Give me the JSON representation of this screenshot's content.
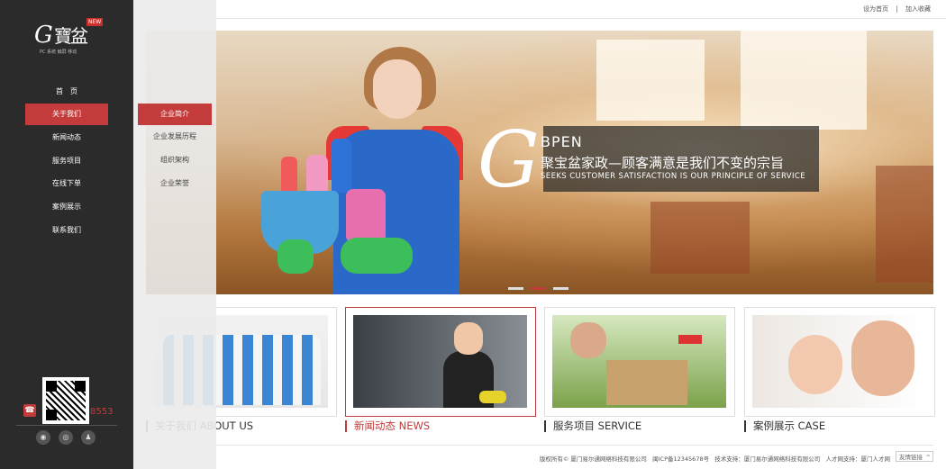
{
  "sidebar": {
    "logo": {
      "letter": "G",
      "chinese": "寶盆",
      "badge": "NEW",
      "subtitle": "PC 系统 触屏 移动"
    },
    "nav": [
      {
        "label": "首　页",
        "active": false
      },
      {
        "label": "关于我们",
        "active": true
      },
      {
        "label": "新闻动态",
        "active": false
      },
      {
        "label": "服务项目",
        "active": false
      },
      {
        "label": "在线下单",
        "active": false
      },
      {
        "label": "案例展示",
        "active": false
      },
      {
        "label": "联系我们",
        "active": false
      }
    ],
    "phone_icon": "phone-icon",
    "phone_partial": "8553",
    "social": [
      {
        "icon": "weibo-icon",
        "glyph": "◉"
      },
      {
        "icon": "wechat-icon",
        "glyph": "◎"
      },
      {
        "icon": "qq-icon",
        "glyph": "♟"
      }
    ]
  },
  "subnav": {
    "items": [
      {
        "label": "企业简介",
        "active": true
      },
      {
        "label": "企业发展历程",
        "active": false
      },
      {
        "label": "组织架构",
        "active": false
      },
      {
        "label": "企业荣誉",
        "active": false
      }
    ]
  },
  "topbar": {
    "set_home": "设为首页",
    "divider": "|",
    "add_favorite": "加入收藏"
  },
  "banner": {
    "logo_letter": "G",
    "title": "BPEN",
    "slogan_cn": "聚宝盆家政—顾客满意是我们不变的宗旨",
    "slogan_en": "SEEKS CUSTOMER SATISFACTION IS OUR PRINCIPLE OF SERVICE",
    "slides": 3,
    "active_slide": 2
  },
  "cards": [
    {
      "title": "关于我们 ABOUT US",
      "active": false
    },
    {
      "title": "新闻动态 NEWS",
      "active": true
    },
    {
      "title": "服务项目 SERVICE",
      "active": false
    },
    {
      "title": "案例展示 CASE",
      "active": false
    }
  ],
  "footer": {
    "copyright": "版权所有© 厦门易尔通网络科技有限公司",
    "icp": "闽ICP备12345678号",
    "tech": "技术支持：厦门易尔通网络科技有限公司",
    "talent": "人才网支持：厦门人才网",
    "friend_links": "友情链接",
    "friend_arrow": "^"
  },
  "colors": {
    "accent": "#c43b3b",
    "sidebar": "#2b2b2b"
  }
}
